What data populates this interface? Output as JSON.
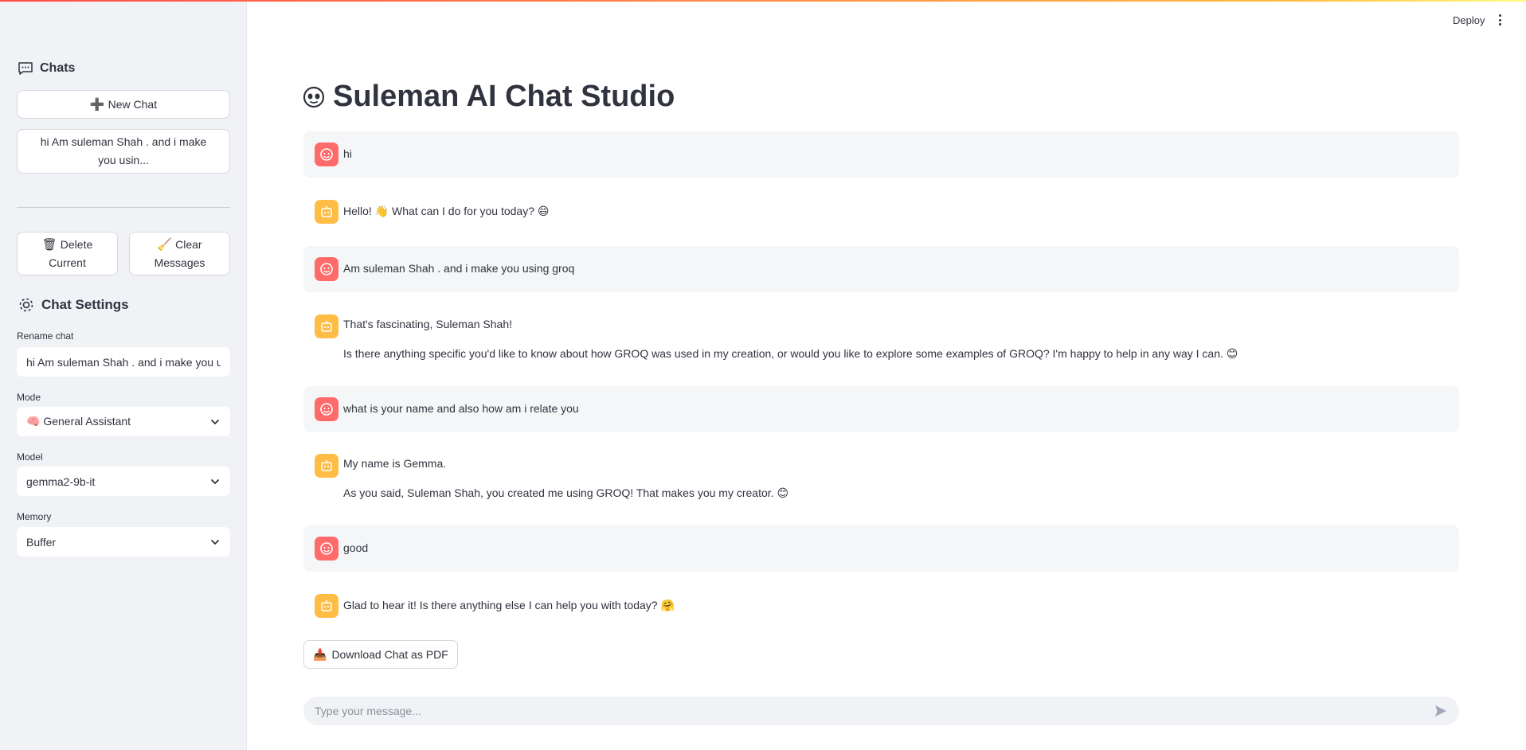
{
  "header": {
    "deploy_label": "Deploy",
    "menu_icon": "kebab-menu-icon"
  },
  "sidebar": {
    "chats_heading": "Chats",
    "new_chat_label": "New Chat",
    "chat_list": [
      {
        "label": "hi Am suleman Shah . and i make you usin..."
      }
    ],
    "delete_current_label": "Delete Current",
    "clear_messages_label": "Clear Messages",
    "settings_heading": "Chat Settings",
    "rename_label": "Rename chat",
    "rename_value": "hi Am suleman Shah . and i make you using groq",
    "mode_label": "Mode",
    "mode_value": "🧠 General Assistant",
    "model_label": "Model",
    "model_value": "gemma2-9b-it",
    "memory_label": "Memory",
    "memory_value": "Buffer"
  },
  "main": {
    "title": "Suleman AI Chat Studio",
    "messages": [
      {
        "role": "user",
        "lines": [
          "hi"
        ]
      },
      {
        "role": "assistant",
        "lines": [
          "Hello! 👋 What can I do for you today? 😄"
        ]
      },
      {
        "role": "user",
        "lines": [
          "Am suleman Shah . and i make you using groq"
        ]
      },
      {
        "role": "assistant",
        "lines": [
          "That's fascinating, Suleman Shah!",
          "Is there anything specific you'd like to know about how GROQ was used in my creation, or would you like to explore some examples of GROQ? I'm happy to help in any way I can. 😊"
        ]
      },
      {
        "role": "user",
        "lines": [
          "what is your name and also how am i relate you"
        ]
      },
      {
        "role": "assistant",
        "lines": [
          "My name is Gemma.",
          "As you said, Suleman Shah, you created me using GROQ! That makes you my creator. 😊"
        ]
      },
      {
        "role": "user",
        "lines": [
          "good"
        ]
      },
      {
        "role": "assistant",
        "lines": [
          "Glad to hear it! Is there anything else I can help you with today? 🤗"
        ]
      }
    ],
    "download_label": "Download Chat as PDF",
    "input_placeholder": "Type your message..."
  },
  "colors": {
    "user_avatar": "#ff6b6b",
    "assistant_avatar": "#ffbd45",
    "sidebar_bg": "#f0f2f6"
  }
}
